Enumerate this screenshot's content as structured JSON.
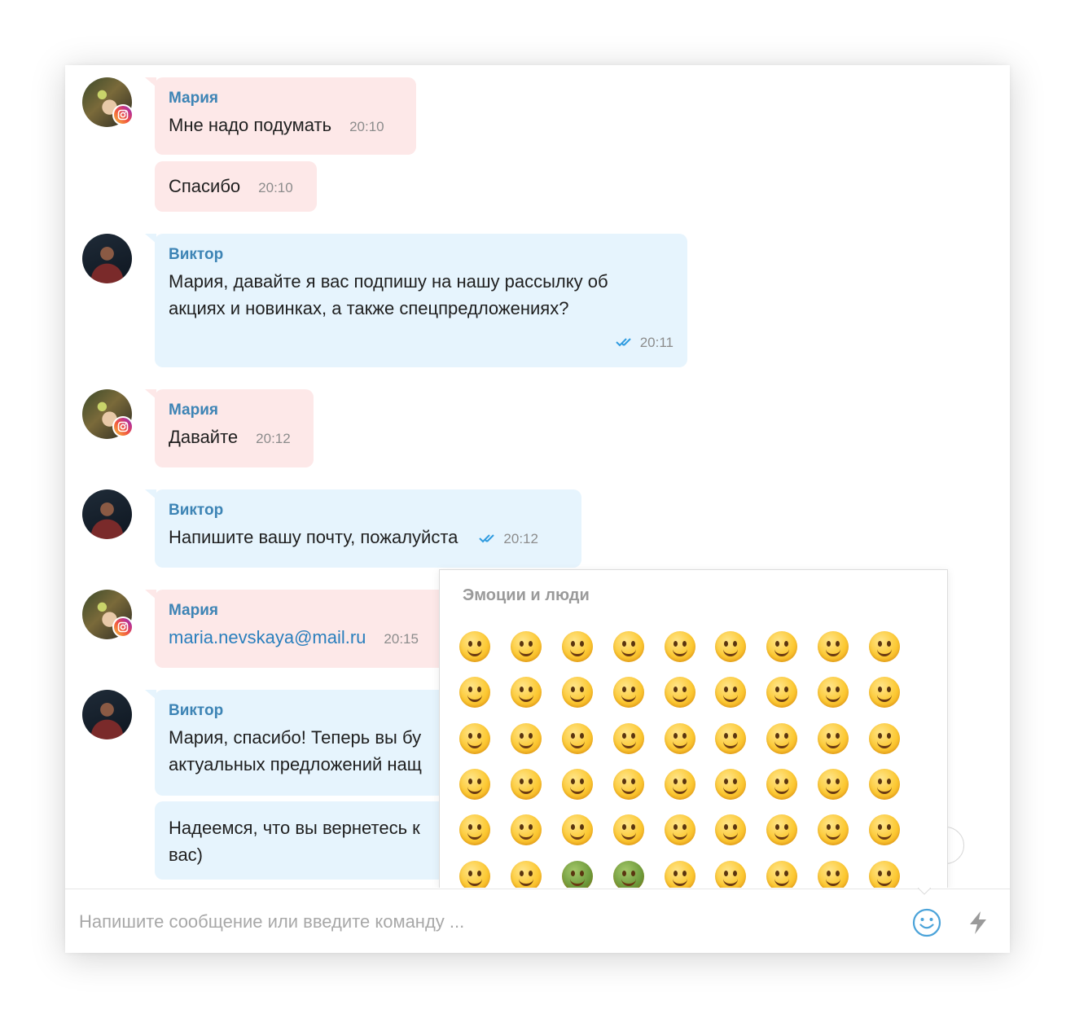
{
  "messages": [
    {
      "author": "Мария",
      "text": "Мне надо подумать",
      "time": "20:10"
    },
    {
      "text": "Спасибо",
      "time": "20:10"
    },
    {
      "author": "Виктор",
      "lines": [
        "Мария, давайте я вас подпишу на нашу рассылку об",
        "акциях и новинках, а также спецпредложениях?"
      ],
      "time": "20:11"
    },
    {
      "author": "Мария",
      "text": "Давайте",
      "time": "20:12"
    },
    {
      "author": "Виктор",
      "text": "Напишите вашу почту, пожалуйста",
      "time": "20:12"
    },
    {
      "author": "Мария",
      "text": "maria.nevskaya@mail.ru",
      "time": "20:15"
    },
    {
      "author": "Виктор",
      "lines": [
        "Мария, спасибо! Теперь вы бу",
        "актуальных предложений нащ"
      ]
    },
    {
      "lines": [
        "Надеемся, что вы вернетесь к",
        "вас)"
      ]
    }
  ],
  "emoji_panel": {
    "title": "Эмоции и люди",
    "emojis": [
      "😀",
      "😃",
      "😄",
      "😁",
      "😆",
      "😅",
      "🤣",
      "😂",
      "🙂",
      "🙃",
      "😉",
      "😊",
      "😇",
      "😍",
      "🤩",
      "😘",
      "😗",
      "😚",
      "😙",
      "😋",
      "😛",
      "😜",
      "🤪",
      "😝",
      "🤑",
      "🤗",
      "🤭",
      "🤫",
      "🤔",
      "🤐",
      "🤨",
      "😐",
      "😑",
      "😶",
      "😏",
      "😒",
      "🙄",
      "😬",
      "🤥",
      "😌",
      "😔",
      "😪",
      "🤤",
      "😴",
      "😷",
      "🤒",
      "🤕",
      "🤢",
      "🤮",
      "🤧",
      "😵",
      "🤯",
      "🤠",
      "😎"
    ]
  },
  "composer": {
    "placeholder": "Напишите сообщение или введите команду ..."
  },
  "icons": {
    "emoji_button": "smiley-icon",
    "quick_commands": "lightning-icon",
    "read_status": "double-check-icon",
    "source_badge": "instagram-icon"
  },
  "colors": {
    "incoming_bubble": "#fde8e8",
    "outgoing_bubble": "#e6f4fd",
    "author_name": "#3d84b5",
    "read_ticks": "#2f9be0",
    "link": "#2a7fbd"
  }
}
